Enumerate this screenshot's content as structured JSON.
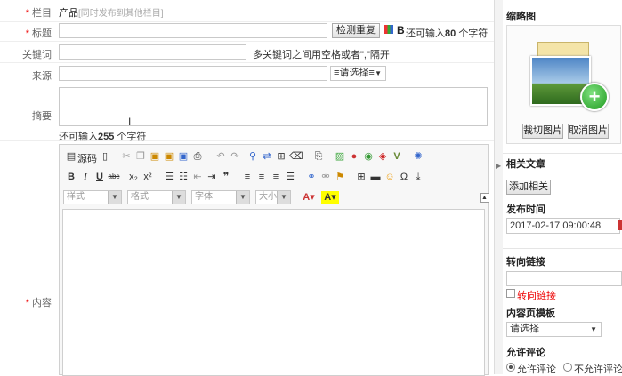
{
  "form": {
    "column": {
      "label": "栏目",
      "value": "产品",
      "hint": "[同时发布到其他栏目]"
    },
    "title": {
      "label": "标题",
      "check_button": "检测重复",
      "hint_prefix": "还可输入",
      "hint_count": "80",
      "hint_suffix": "个字符"
    },
    "keywords": {
      "label": "关键词",
      "hint": "多关键词之间用空格或者\",\"隔开"
    },
    "source": {
      "label": "来源",
      "select": "≡请选择≡"
    },
    "summary": {
      "label": "摘要",
      "hint_prefix": "还可输入",
      "hint_count": "255",
      "hint_suffix": "个字符"
    },
    "content": {
      "label": "内容"
    }
  },
  "editor": {
    "source_label": "源码",
    "style_select": "样式",
    "format_select": "格式",
    "font_select": "字体",
    "size_select": "大小"
  },
  "sidebar": {
    "thumbnail": {
      "title": "缩略图",
      "crop_button": "裁切图片",
      "cancel_button": "取消图片"
    },
    "related": {
      "title": "相关文章",
      "add_button": "添加相关"
    },
    "publish_time": {
      "title": "发布时间",
      "value": "2017-02-17 09:00:48"
    },
    "redirect": {
      "title": "转向链接",
      "checkbox_label": "转向链接"
    },
    "template": {
      "title": "内容页模板",
      "select": "请选择"
    },
    "comments": {
      "title": "允许评论",
      "allow": "允许评论",
      "deny": "不允许评论"
    }
  },
  "colors": {
    "accent": "#e00000",
    "border": "#c9c9c9",
    "panel": "#f3f3f3"
  }
}
